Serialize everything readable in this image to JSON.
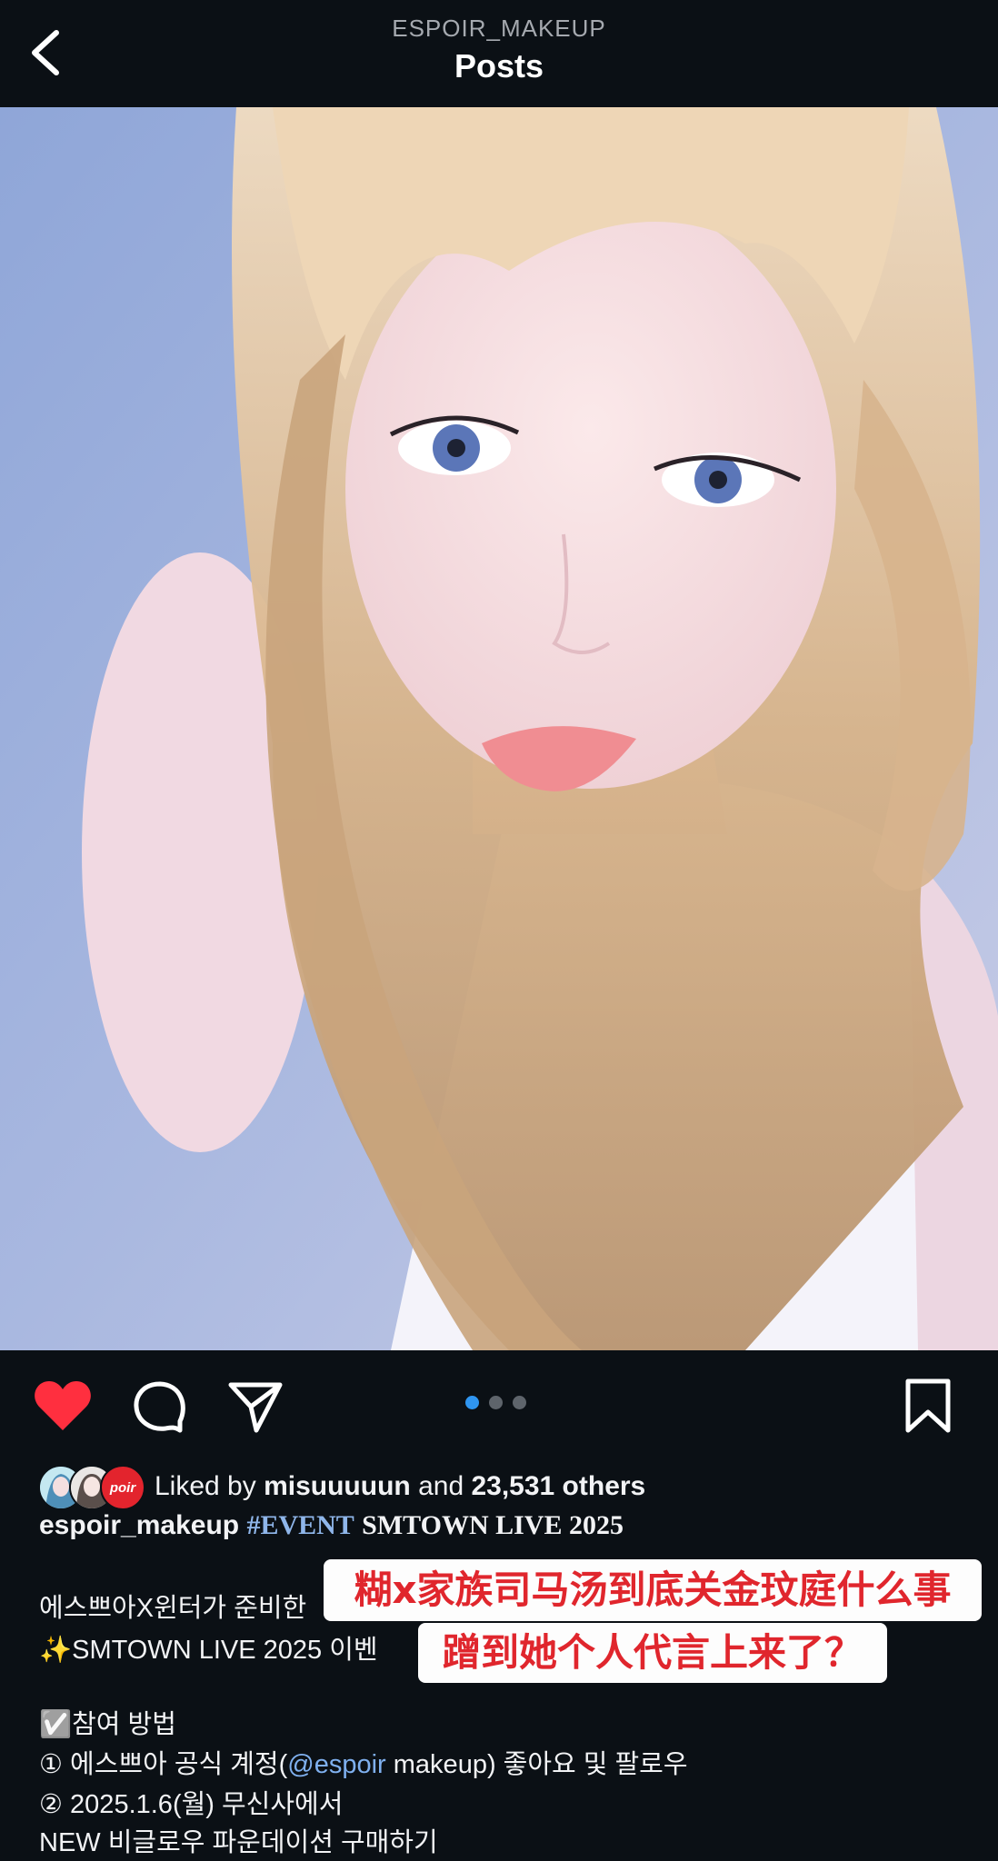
{
  "header": {
    "account": "ESPOIR_MAKEUP",
    "title": "Posts"
  },
  "post": {
    "likes": {
      "prefix": "Liked by ",
      "user": "misuuuuun",
      "middle": " and ",
      "count": "23,531 others"
    },
    "avatar_badge": "poir",
    "caption": {
      "username": "espoir_makeup",
      "hashtag": "#EVENT",
      "title_rest": "SMTOWN LIVE 2025",
      "line1": "에스쁘아X윈터가 준비한",
      "line2": "✨SMTOWN LIVE 2025 이벤",
      "line3_icon": "✅",
      "line3": "참여 방법",
      "line4_a": "① 에스쁘아 공식 계정(",
      "line4_mention": "@espoir",
      "line4_b": " makeup) 좋아요 및 팔로우",
      "line5": "② 2025.1.6(월) 무신사에서",
      "line6": "NEW 비글로우 파운데이션 구매하기"
    },
    "carousel": {
      "count": 3,
      "active": 1
    }
  },
  "overlay": {
    "line1": "糊x家族司马汤到底关金玟庭什么事",
    "line2": "蹭到她个人代言上来了？"
  },
  "icons": [
    "back-icon",
    "heart-icon",
    "comment-icon",
    "share-icon",
    "bookmark-icon"
  ],
  "colors": {
    "background": "#0b1015",
    "heart": "#ff2f3f",
    "dot_active": "#2f95f0",
    "hashtag": "#8fb6ea",
    "overlay_text": "#e0262d"
  }
}
